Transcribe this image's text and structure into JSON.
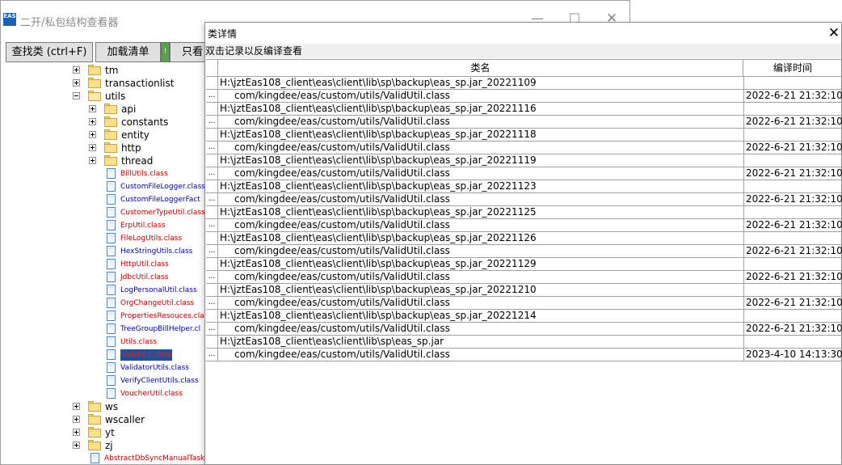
{
  "main_window": {
    "app_icon_text": "EAS",
    "title": "二开/私包结构查看器",
    "controls": {
      "minimize": "—",
      "maximize": "☐",
      "close": "✕"
    }
  },
  "toolbar": {
    "find_label": "查找类 (ctrl+F)",
    "load_label": "加载清单",
    "green_label": "!",
    "only_label": "只看"
  },
  "tree": {
    "folders_top": [
      {
        "label": "tm",
        "expanded": false
      },
      {
        "label": "transactionlist",
        "expanded": false
      },
      {
        "label": "utils",
        "expanded": true
      }
    ],
    "utils_children": [
      {
        "label": "api"
      },
      {
        "label": "constants"
      },
      {
        "label": "entity"
      },
      {
        "label": "http"
      },
      {
        "label": "thread"
      }
    ],
    "class_files": [
      {
        "label": "BillUtils.class",
        "color": "#c00000"
      },
      {
        "label": "CustomFileLogger.class",
        "color": "#0000a0"
      },
      {
        "label": "CustomFileLoggerFact",
        "color": "#0000a0"
      },
      {
        "label": "CustomerTypeUtil.class",
        "color": "#c00000"
      },
      {
        "label": "ErpUtil.class",
        "color": "#c00000"
      },
      {
        "label": "FileLogUtils.class",
        "color": "#c00000"
      },
      {
        "label": "HexStringUtils.class",
        "color": "#0000a0"
      },
      {
        "label": "HttpUtil.class",
        "color": "#c00000"
      },
      {
        "label": "JdbcUtil.class",
        "color": "#c00000"
      },
      {
        "label": "LogPersonalUtil.class",
        "color": "#0000a0"
      },
      {
        "label": "OrgChangeUtil.class",
        "color": "#c00000"
      },
      {
        "label": "PropertiesResouces.cla",
        "color": "#c00000"
      },
      {
        "label": "TreeGroupBillHelper.cl",
        "color": "#0000a0"
      },
      {
        "label": "Utils.class",
        "color": "#c00000"
      },
      {
        "label": "ValidUtil.class",
        "color": "#c00000",
        "selected": true
      },
      {
        "label": "ValidatorUtils.class",
        "color": "#0000a0"
      },
      {
        "label": "VerifyClientUtils.class",
        "color": "#0000a0"
      },
      {
        "label": "VoucherUtil.class",
        "color": "#c00000"
      }
    ],
    "folders_bottom": [
      {
        "label": "ws"
      },
      {
        "label": "wscaller"
      },
      {
        "label": "yt"
      },
      {
        "label": "zj"
      }
    ],
    "last_file": {
      "label": "AbstractDbSyncManualTask",
      "color": "#c00000"
    }
  },
  "dialog": {
    "title": "类详情",
    "close": "✕",
    "hint": "双击记录以反编译查看",
    "headers": {
      "class_name": "类名",
      "compile_time": "编译时间"
    },
    "rows": [
      {
        "num": "",
        "name": "H:\\jztEas108_client\\eas\\client\\lib\\sp\\backup\\eas_sp.jar_20221109",
        "time": "",
        "kind": "path"
      },
      {
        "num": "...",
        "name": "com/kingdee/eas/custom/utils/ValidUtil.class",
        "time": "2022-6-21 21:32:10",
        "kind": "class"
      },
      {
        "num": "",
        "name": "H:\\jztEas108_client\\eas\\client\\lib\\sp\\backup\\eas_sp.jar_20221116",
        "time": "",
        "kind": "path"
      },
      {
        "num": "...",
        "name": "com/kingdee/eas/custom/utils/ValidUtil.class",
        "time": "2022-6-21 21:32:10",
        "kind": "class"
      },
      {
        "num": "",
        "name": "H:\\jztEas108_client\\eas\\client\\lib\\sp\\backup\\eas_sp.jar_20221118",
        "time": "",
        "kind": "path"
      },
      {
        "num": "...",
        "name": "com/kingdee/eas/custom/utils/ValidUtil.class",
        "time": "2022-6-21 21:32:10",
        "kind": "class"
      },
      {
        "num": "",
        "name": "H:\\jztEas108_client\\eas\\client\\lib\\sp\\backup\\eas_sp.jar_20221119",
        "time": "",
        "kind": "path"
      },
      {
        "num": "...",
        "name": "com/kingdee/eas/custom/utils/ValidUtil.class",
        "time": "2022-6-21 21:32:10",
        "kind": "class"
      },
      {
        "num": "",
        "name": "H:\\jztEas108_client\\eas\\client\\lib\\sp\\backup\\eas_sp.jar_20221123",
        "time": "",
        "kind": "path"
      },
      {
        "num": "...",
        "name": "com/kingdee/eas/custom/utils/ValidUtil.class",
        "time": "2022-6-21 21:32:10",
        "kind": "class"
      },
      {
        "num": "",
        "name": "H:\\jztEas108_client\\eas\\client\\lib\\sp\\backup\\eas_sp.jar_20221125",
        "time": "",
        "kind": "path"
      },
      {
        "num": "...",
        "name": "com/kingdee/eas/custom/utils/ValidUtil.class",
        "time": "2022-6-21 21:32:10",
        "kind": "class"
      },
      {
        "num": "",
        "name": "H:\\jztEas108_client\\eas\\client\\lib\\sp\\backup\\eas_sp.jar_20221126",
        "time": "",
        "kind": "path"
      },
      {
        "num": "...",
        "name": "com/kingdee/eas/custom/utils/ValidUtil.class",
        "time": "2022-6-21 21:32:10",
        "kind": "class"
      },
      {
        "num": "",
        "name": "H:\\jztEas108_client\\eas\\client\\lib\\sp\\backup\\eas_sp.jar_20221129",
        "time": "",
        "kind": "path"
      },
      {
        "num": "...",
        "name": "com/kingdee/eas/custom/utils/ValidUtil.class",
        "time": "2022-6-21 21:32:10",
        "kind": "class"
      },
      {
        "num": "",
        "name": "H:\\jztEas108_client\\eas\\client\\lib\\sp\\backup\\eas_sp.jar_20221210",
        "time": "",
        "kind": "path"
      },
      {
        "num": "...",
        "name": "com/kingdee/eas/custom/utils/ValidUtil.class",
        "time": "2022-6-21 21:32:10",
        "kind": "class"
      },
      {
        "num": "",
        "name": "H:\\jztEas108_client\\eas\\client\\lib\\sp\\backup\\eas_sp.jar_20221214",
        "time": "",
        "kind": "path"
      },
      {
        "num": "...",
        "name": "com/kingdee/eas/custom/utils/ValidUtil.class",
        "time": "2022-6-21 21:32:10",
        "kind": "class"
      },
      {
        "num": "",
        "name": "H:\\jztEas108_client\\eas\\client\\lib\\sp\\eas_sp.jar",
        "time": "",
        "kind": "path"
      },
      {
        "num": "...",
        "name": "com/kingdee/eas/custom/utils/ValidUtil.class",
        "time": "2023-4-10 14:13:30",
        "kind": "class"
      }
    ]
  }
}
